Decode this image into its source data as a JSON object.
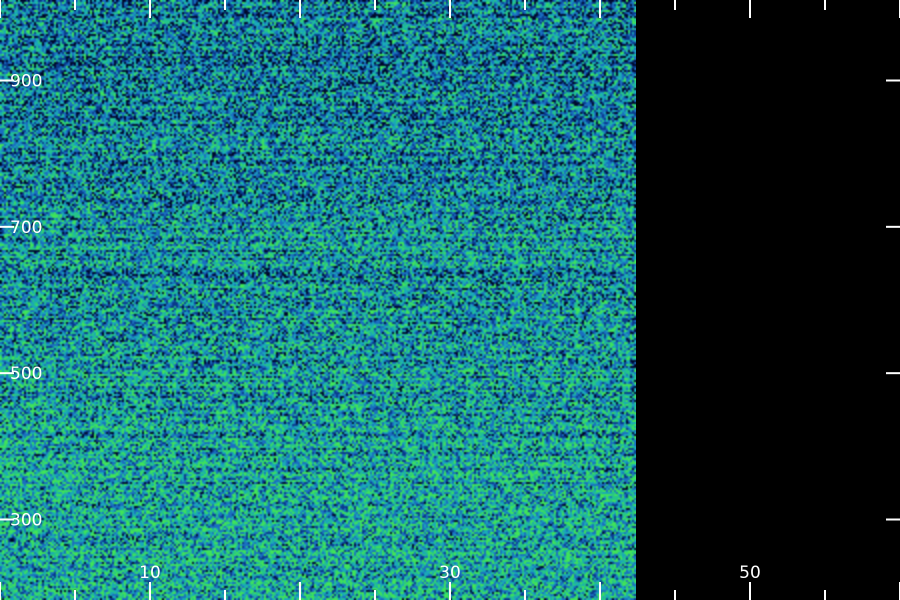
{
  "chart_data": {
    "type": "heatmap",
    "x_ticks": [
      {
        "value": 10,
        "label": "10"
      },
      {
        "value": 30,
        "label": "30"
      },
      {
        "value": 50,
        "label": "50"
      }
    ],
    "y_ticks": [
      {
        "value": 300,
        "label": "300"
      },
      {
        "value": 500,
        "label": "500"
      },
      {
        "value": 700,
        "label": "700"
      },
      {
        "value": 900,
        "label": "900"
      }
    ],
    "xlim": [
      0,
      60
    ],
    "ylim": [
      190,
      1010
    ],
    "data_extent_x": [
      0,
      42.4
    ],
    "noise_seed": 7,
    "grid": false,
    "colormap": [
      "#000a2e",
      "#0a3a8c",
      "#1a6fc0",
      "#1aa8b8",
      "#25c48a",
      "#3fe25a"
    ],
    "background_color": "#000000",
    "tick_color": "#ffffff"
  }
}
